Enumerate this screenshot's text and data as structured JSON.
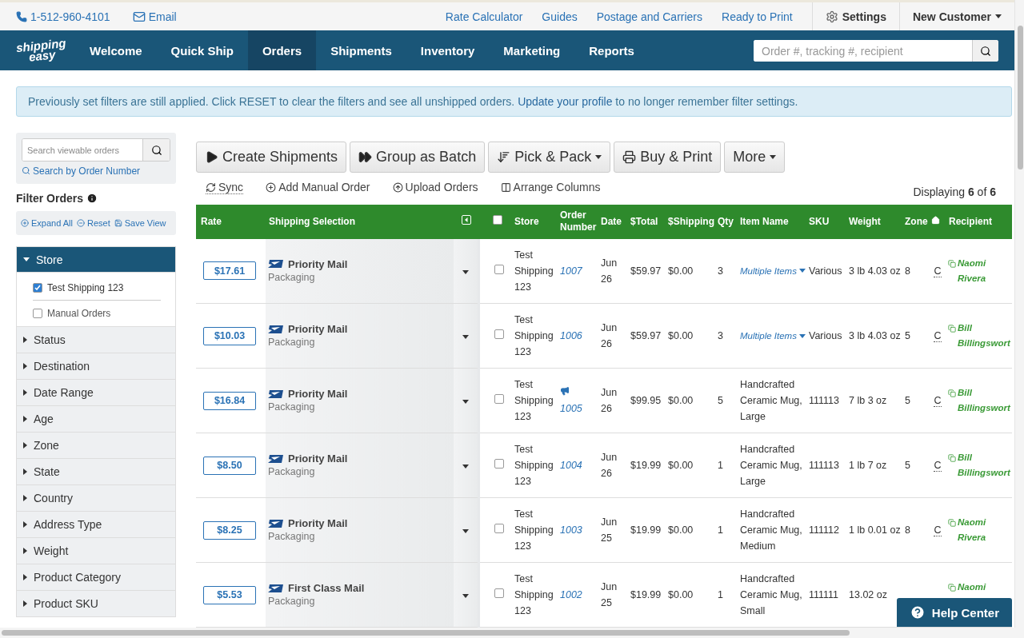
{
  "top_bar": {
    "phone": "1-512-960-4101",
    "email": "Email",
    "links": [
      "Rate Calculator",
      "Guides",
      "Postage and Carriers",
      "Ready to Print"
    ],
    "settings": "Settings",
    "account": "New Customer"
  },
  "nav": {
    "logo": [
      "shipping",
      "easy"
    ],
    "items": [
      {
        "label": "Welcome",
        "selected": false
      },
      {
        "label": "Quick Ship",
        "selected": false
      },
      {
        "label": "Orders",
        "selected": true
      },
      {
        "label": "Shipments",
        "selected": false
      },
      {
        "label": "Inventory",
        "selected": false
      },
      {
        "label": "Marketing",
        "selected": false
      },
      {
        "label": "Reports",
        "selected": false
      }
    ],
    "search": {
      "placeholder": "Order #, tracking #, recipient"
    }
  },
  "alert": {
    "text": "Previously set filters are still applied. Click RESET to clear the filters and see all unshipped orders.",
    "link": "Update your profile",
    "text_after": "to no longer remember filter settings."
  },
  "sidebar": {
    "search": {
      "placeholder": "Search viewable orders"
    },
    "search_link": "Search by Order Number",
    "filter_title": "Filter Orders",
    "actions": [
      "Expand All",
      "Reset",
      "Save View"
    ],
    "filters": [
      {
        "label": "Store",
        "expanded": true,
        "options": [
          {
            "label": "Test Shipping 123",
            "checked": true
          },
          {
            "label": "Manual Orders",
            "checked": false
          }
        ]
      },
      {
        "label": "Status",
        "expanded": false
      },
      {
        "label": "Destination",
        "expanded": false
      },
      {
        "label": "Date Range",
        "expanded": false
      },
      {
        "label": "Age",
        "expanded": false
      },
      {
        "label": "Zone",
        "expanded": false
      },
      {
        "label": "State",
        "expanded": false
      },
      {
        "label": "Country",
        "expanded": false
      },
      {
        "label": "Address Type",
        "expanded": false
      },
      {
        "label": "Weight",
        "expanded": false
      },
      {
        "label": "Product Category",
        "expanded": false
      },
      {
        "label": "Product SKU",
        "expanded": false
      }
    ]
  },
  "toolbar": {
    "buttons": [
      {
        "label": "Create Shipments",
        "dropdown": false
      },
      {
        "label": "Group as Batch",
        "dropdown": false
      },
      {
        "label": "Pick & Pack",
        "dropdown": true
      },
      {
        "label": "Buy & Print",
        "dropdown": false
      },
      {
        "label": "More",
        "dropdown": true
      }
    ],
    "actions": [
      "Sync",
      "Add Manual Order",
      "Upload Orders",
      "Arrange Columns"
    ],
    "display": "Displaying **6** of **6**"
  },
  "table": {
    "columns": [
      "Rate",
      "Shipping Selection",
      "Store",
      "Order Number",
      "Date",
      "$Total",
      "$Shipping",
      "Qty",
      "Item Name",
      "SKU",
      "Weight",
      "Zone",
      "Recipient"
    ],
    "select_all": false,
    "rows": [
      {
        "rate": "$17.61",
        "service": "Priority Mail",
        "package": "Packaging",
        "selected": false,
        "store": "Test Shipping 123",
        "order": "1007",
        "flagged": false,
        "date": "Jun 26",
        "total": "$59.97",
        "shipping": "$0.00",
        "qty": "3",
        "kind": "multiple",
        "item": "Multiple Items",
        "sku": "Various",
        "weight": "3 lb 4.03 oz",
        "zone": "8",
        "residential": "C",
        "recipient": "Naomi Rivera"
      },
      {
        "rate": "$10.03",
        "service": "Priority Mail",
        "package": "Packaging",
        "selected": false,
        "store": "Test Shipping 123",
        "order": "1006",
        "flagged": false,
        "date": "Jun 26",
        "total": "$59.97",
        "shipping": "$0.00",
        "qty": "3",
        "kind": "multiple",
        "item": "Multiple Items",
        "sku": "Various",
        "weight": "3 lb 4.03 oz",
        "zone": "5",
        "residential": "C",
        "recipient": "Bill Billingswort"
      },
      {
        "rate": "$16.84",
        "service": "Priority Mail",
        "package": "Packaging",
        "selected": false,
        "store": "Test Shipping 123",
        "order": "1005",
        "flagged": true,
        "date": "Jun 26",
        "total": "$99.95",
        "shipping": "$0.00",
        "qty": "5",
        "kind": "single",
        "item": "Handcrafted Ceramic Mug, Large",
        "sku": "111113",
        "weight": "7 lb 3 oz",
        "zone": "5",
        "residential": "C",
        "recipient": "Bill Billingswort"
      },
      {
        "rate": "$8.50",
        "service": "Priority Mail",
        "package": "Packaging",
        "selected": false,
        "store": "Test Shipping 123",
        "order": "1004",
        "flagged": false,
        "date": "Jun 26",
        "total": "$19.99",
        "shipping": "$0.00",
        "qty": "1",
        "kind": "single",
        "item": "Handcrafted Ceramic Mug, Large",
        "sku": "111113",
        "weight": "1 lb 7 oz",
        "zone": "5",
        "residential": "C",
        "recipient": "Bill Billingswort"
      },
      {
        "rate": "$8.25",
        "service": "Priority Mail",
        "package": "Packaging",
        "selected": false,
        "store": "Test Shipping 123",
        "order": "1003",
        "flagged": false,
        "date": "Jun 25",
        "total": "$19.99",
        "shipping": "$0.00",
        "qty": "1",
        "kind": "single",
        "item": "Handcrafted Ceramic Mug, Medium",
        "sku": "111112",
        "weight": "1 lb 0.01 oz",
        "zone": "8",
        "residential": "C",
        "recipient": "Naomi Rivera"
      },
      {
        "rate": "$5.53",
        "service": "First Class Mail",
        "package": "Packaging",
        "selected": false,
        "store": "Test Shipping 123",
        "order": "1002",
        "flagged": false,
        "date": "Jun 25",
        "total": "$19.99",
        "shipping": "$0.00",
        "qty": "1",
        "kind": "single",
        "item": "Handcrafted Ceramic Mug, Small",
        "sku": "111111",
        "weight": "13.02 oz",
        "recipient": "Naomi"
      }
    ]
  },
  "help_center": "Help Center"
}
